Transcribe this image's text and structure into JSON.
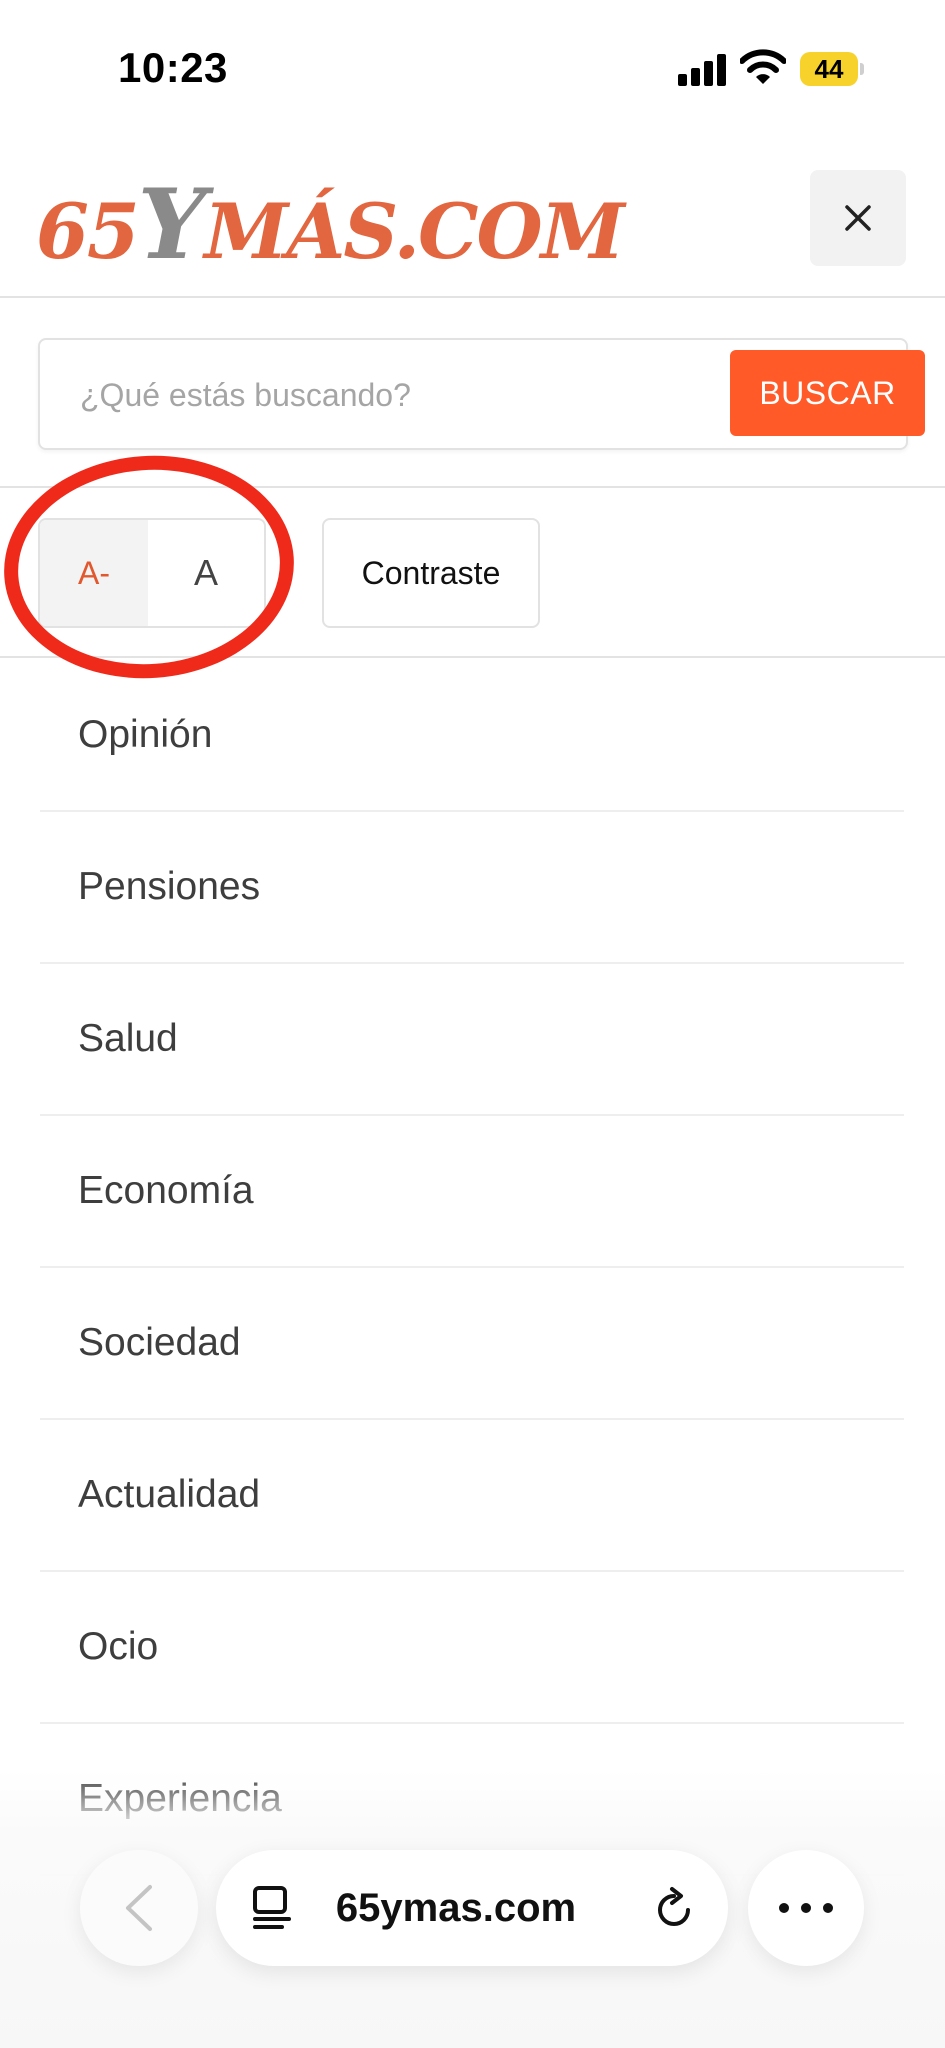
{
  "status_bar": {
    "time": "10:23",
    "battery_level": "44"
  },
  "header": {
    "logo_text_a": "65",
    "logo_text_y": "Y",
    "logo_text_b": "MÁS.COM"
  },
  "search": {
    "placeholder": "¿Qué estás buscando?",
    "button_label": "BUSCAR"
  },
  "accessibility": {
    "font_decrease_label": "A-",
    "font_normal_label": "A",
    "contrast_label": "Contraste"
  },
  "nav": {
    "items": [
      {
        "label": "Opinión"
      },
      {
        "label": "Pensiones"
      },
      {
        "label": "Salud"
      },
      {
        "label": "Economía"
      },
      {
        "label": "Sociedad"
      },
      {
        "label": "Actualidad"
      },
      {
        "label": "Ocio"
      },
      {
        "label": "Experiencia"
      }
    ]
  },
  "browser": {
    "url": "65ymas.com"
  },
  "colors": {
    "accent": "#ff5a27",
    "annotation": "#f02a1a"
  },
  "icons": {
    "close": "close-icon",
    "back": "chevron-left-icon",
    "reader": "reader-icon",
    "reload": "reload-icon",
    "more": "more-icon"
  }
}
